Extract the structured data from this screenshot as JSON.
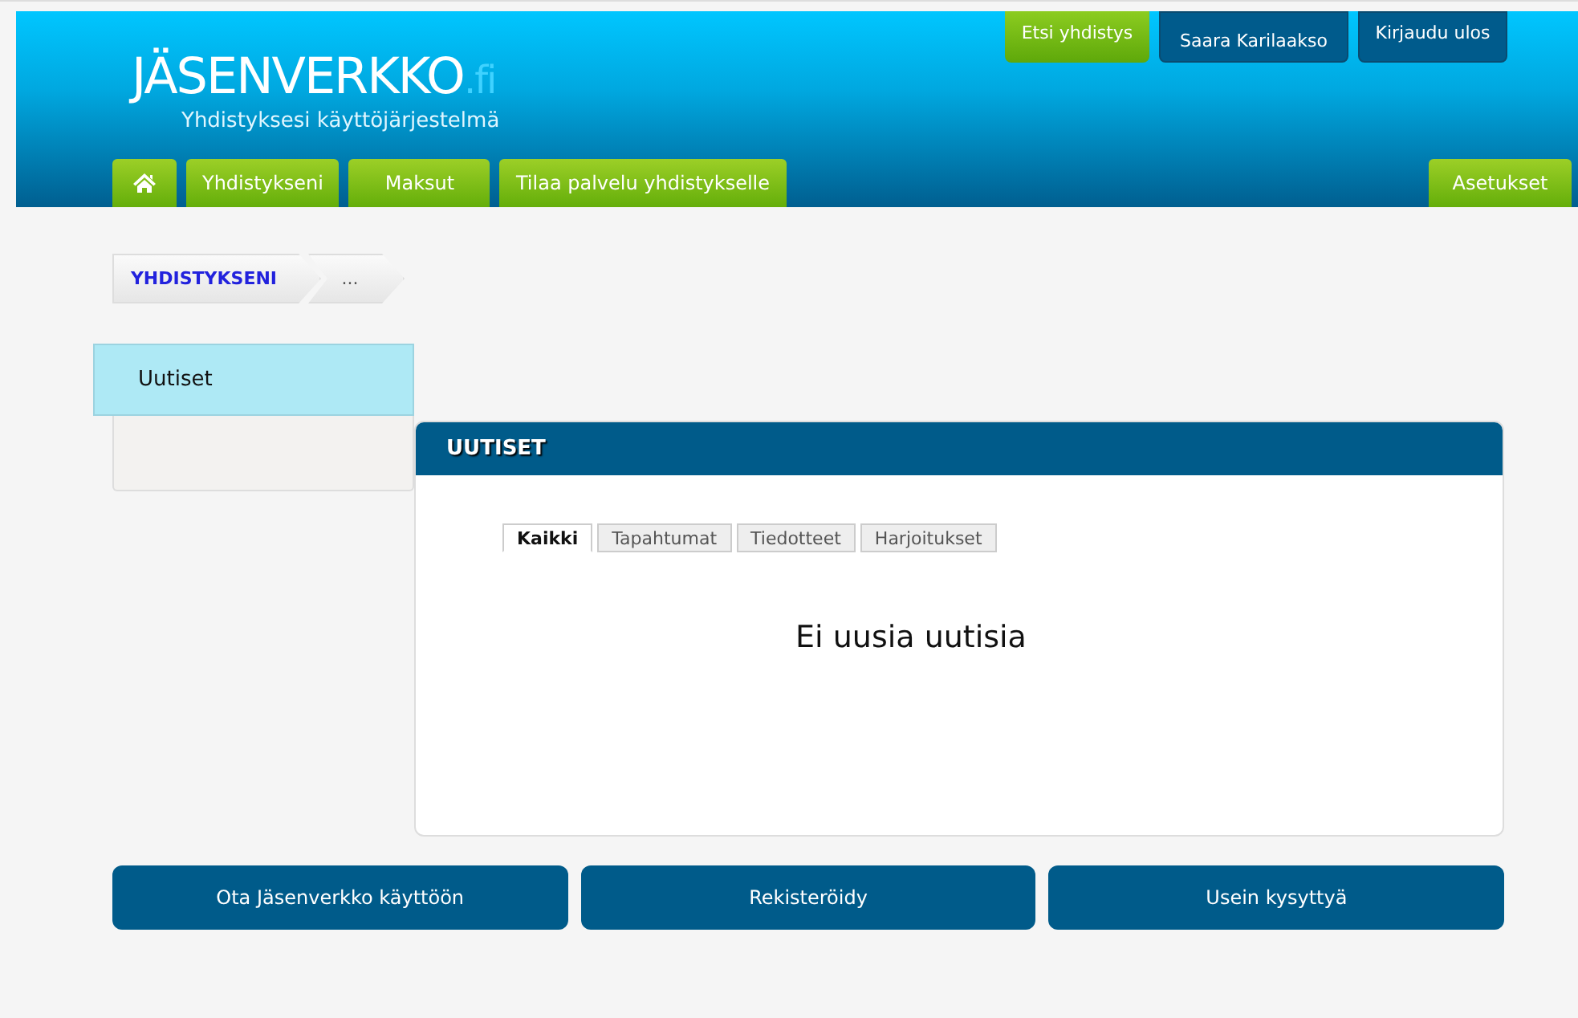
{
  "logo": {
    "name": "JÄSENVERKKO",
    "suffix": ".fi",
    "tagline": "Yhdistyksesi käyttöjärjestelmä"
  },
  "top_links": [
    {
      "label": "Etsi yhdistys",
      "kind": "green"
    },
    {
      "label": "Saara Karilaakso",
      "kind": "blue"
    },
    {
      "label": "Kirjaudu ulos",
      "kind": "blue"
    }
  ],
  "nav": [
    {
      "label": "Yhdistykseni"
    },
    {
      "label": "Maksut"
    },
    {
      "label": "Tilaa palvelu yhdistykselle"
    }
  ],
  "nav_right": "Asetukset",
  "breadcrumb": [
    "YHDISTYKSENI",
    "..."
  ],
  "side_menu": [
    {
      "label": "Uutiset",
      "selected": true
    }
  ],
  "panel": {
    "title": "UUTISET",
    "tabs": [
      {
        "label": "Kaikki",
        "selected": true
      },
      {
        "label": "Tapahtumat",
        "selected": false
      },
      {
        "label": "Tiedotteet",
        "selected": false
      },
      {
        "label": "Harjoitukset",
        "selected": false
      }
    ],
    "message": "Ei uusia uutisia"
  },
  "footer_buttons": [
    "Ota Jäsenverkko käyttöön",
    "Rekisteröidy",
    "Usein kysyttyä"
  ]
}
